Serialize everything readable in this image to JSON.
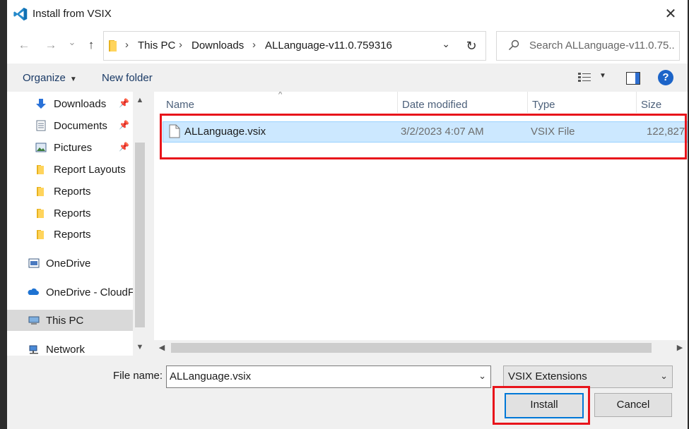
{
  "window": {
    "title": "Install from VSIX",
    "close_glyph": "✕"
  },
  "nav": {
    "back_glyph": "←",
    "forward_glyph": "→",
    "recent_glyph": "⌄",
    "up_glyph": "↑",
    "breadcrumb": [
      "This PC",
      "Downloads",
      "ALLanguage-v11.0.759316"
    ],
    "refresh_glyph": "↻",
    "search_placeholder": "Search ALLanguage-v11.0.75..."
  },
  "commands": {
    "organize": "Organize",
    "new_folder": "New folder",
    "help_glyph": "?"
  },
  "sidebar": {
    "items": [
      {
        "label": "Downloads",
        "icon": "download-arrow-icon",
        "pinned": true
      },
      {
        "label": "Documents",
        "icon": "document-icon",
        "pinned": true
      },
      {
        "label": "Pictures",
        "icon": "pictures-icon",
        "pinned": true
      },
      {
        "label": "Report Layouts",
        "icon": "folder-icon",
        "pinned": false
      },
      {
        "label": "Reports",
        "icon": "folder-icon",
        "pinned": false
      },
      {
        "label": "Reports",
        "icon": "folder-icon",
        "pinned": false
      },
      {
        "label": "Reports",
        "icon": "folder-icon",
        "pinned": false
      },
      {
        "label": "OneDrive",
        "icon": "onedrive-icon",
        "pinned": false
      },
      {
        "label": "OneDrive - CloudF",
        "icon": "cloud-icon",
        "pinned": false
      },
      {
        "label": "This PC",
        "icon": "computer-icon",
        "pinned": false,
        "selected": true
      },
      {
        "label": "Network",
        "icon": "network-icon",
        "pinned": false
      }
    ]
  },
  "files": {
    "columns": [
      "Name",
      "Date modified",
      "Type",
      "Size"
    ],
    "rows": [
      {
        "name": "ALLanguage.vsix",
        "date": "3/2/2023 4:07 AM",
        "type": "VSIX File",
        "size": "122,827",
        "selected": true
      }
    ]
  },
  "footer": {
    "file_name_label": "File name:",
    "file_name_value": "ALLanguage.vsix",
    "filter_value": "VSIX Extensions",
    "install_label": "Install",
    "cancel_label": "Cancel"
  },
  "colors": {
    "accent": "#0078d7",
    "selection": "#cce8ff",
    "highlight_box": "#e8141b"
  }
}
